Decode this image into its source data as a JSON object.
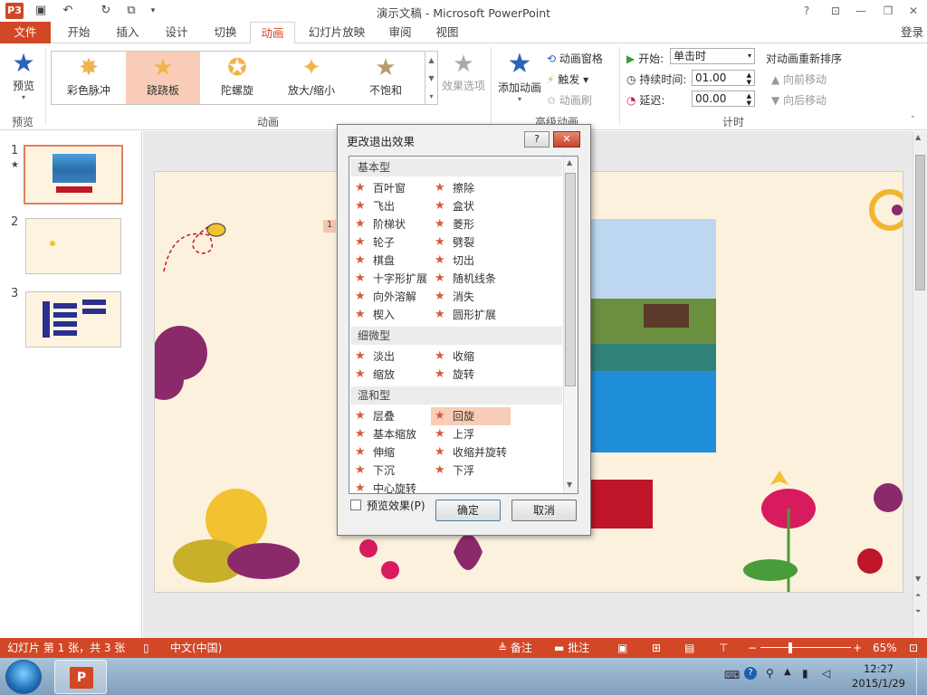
{
  "window": {
    "title": "演示文稿 - Microsoft PowerPoint",
    "app_badge": "P3"
  },
  "tabs": {
    "file": "文件",
    "items": [
      "开始",
      "插入",
      "设计",
      "切换",
      "动画",
      "幻灯片放映",
      "审阅",
      "视图"
    ],
    "active_index": 4,
    "login": "登录"
  },
  "ribbon": {
    "preview": {
      "label": "预览",
      "group": "预览"
    },
    "gallery": {
      "items": [
        "彩色脉冲",
        "跷跷板",
        "陀螺旋",
        "放大/缩小",
        "不饱和"
      ],
      "selected_index": 1
    },
    "effect_options": "效果选项",
    "group_animation": "动画",
    "add_animation": "添加动画",
    "anim_pane": "动画窗格",
    "trigger": "触发",
    "anim_painter": "动画刷",
    "group_advanced": "高级动画",
    "timing": {
      "start_label": "开始:",
      "start_value": "单击时",
      "duration_label": "持续时间:",
      "duration_value": "01.00",
      "delay_label": "延迟:",
      "delay_value": "00.00",
      "reorder": "对动画重新排序",
      "move_earlier": "向前移动",
      "move_later": "向后移动",
      "group": "计时"
    }
  },
  "slides": {
    "numbers": [
      "1",
      "2",
      "3"
    ],
    "selected": 0
  },
  "dialog": {
    "title": "更改退出效果",
    "help": "?",
    "categories": [
      {
        "name": "基本型",
        "items": [
          "百叶窗",
          "擦除",
          "飞出",
          "盒状",
          "阶梯状",
          "菱形",
          "轮子",
          "劈裂",
          "棋盘",
          "切出",
          "十字形扩展",
          "随机线条",
          "向外溶解",
          "消失",
          "楔入",
          "圆形扩展"
        ]
      },
      {
        "name": "细微型",
        "items": [
          "淡出",
          "收缩",
          "缩放",
          "旋转"
        ]
      },
      {
        "name": "温和型",
        "items": [
          "层叠",
          "回旋",
          "基本缩放",
          "上浮",
          "伸缩",
          "收缩并旋转",
          "下沉",
          "下浮",
          "中心旋转"
        ]
      }
    ],
    "selected": "回旋",
    "preview_effect": "预览效果(P)",
    "ok": "确定",
    "cancel": "取消"
  },
  "status": {
    "slide_info": "幻灯片 第 1 张，共 3 张",
    "language": "中文(中国)",
    "notes": "备注",
    "comments": "批注",
    "zoom": "65%"
  },
  "taskbar": {
    "time": "12:27",
    "date": "2015/1/29"
  },
  "colors": {
    "accent": "#d24726",
    "selection": "#f9cdb7",
    "star": "#d25c3d"
  }
}
